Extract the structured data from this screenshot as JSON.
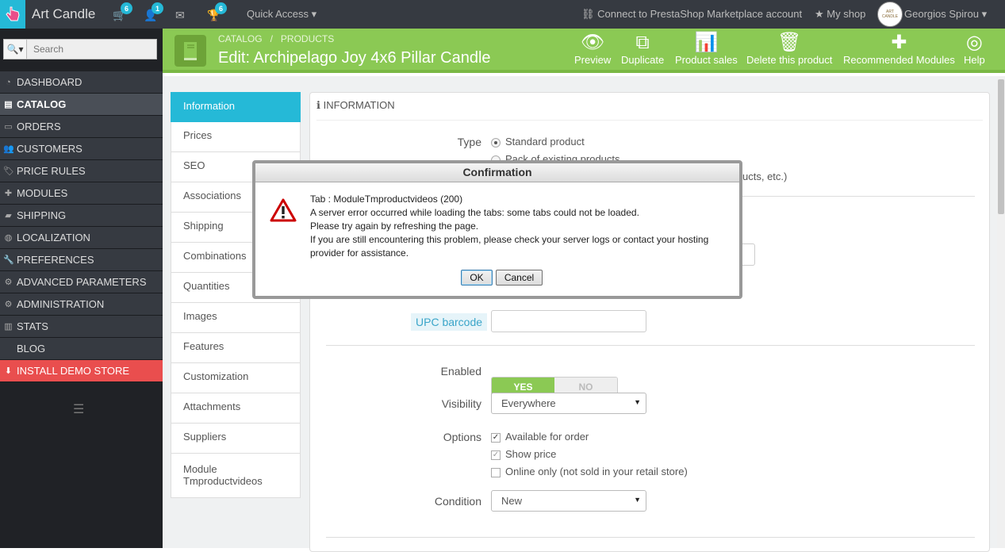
{
  "topbar": {
    "shop_name": "Art Candle",
    "badges": {
      "orders": "6",
      "customers": "1",
      "messages": "",
      "trophy": "6"
    },
    "quick_access": "Quick Access",
    "marketplace": "Connect to PrestaShop Marketplace account",
    "my_shop": "My shop",
    "user": "Georgios Spirou",
    "avatar_text": "ART CANDLE"
  },
  "search": {
    "placeholder": "Search"
  },
  "sidebar": {
    "items": [
      {
        "label": "DASHBOARD",
        "icon": "dashboard-icon"
      },
      {
        "label": "CATALOG",
        "icon": "book-icon"
      },
      {
        "label": "ORDERS",
        "icon": "credit-card-icon"
      },
      {
        "label": "CUSTOMERS",
        "icon": "users-icon"
      },
      {
        "label": "PRICE RULES",
        "icon": "tag-icon"
      },
      {
        "label": "MODULES",
        "icon": "puzzle-icon"
      },
      {
        "label": "SHIPPING",
        "icon": "truck-icon"
      },
      {
        "label": "LOCALIZATION",
        "icon": "globe-icon"
      },
      {
        "label": "PREFERENCES",
        "icon": "wrench-icon"
      },
      {
        "label": "ADVANCED PARAMETERS",
        "icon": "cogs-icon"
      },
      {
        "label": "ADMINISTRATION",
        "icon": "cog-icon"
      },
      {
        "label": "STATS",
        "icon": "bar-chart-icon"
      },
      {
        "label": "BLOG",
        "icon": ""
      },
      {
        "label": "INSTALL DEMO STORE",
        "icon": "download-icon"
      }
    ]
  },
  "header": {
    "breadcrumb": [
      "CATALOG",
      "/",
      "PRODUCTS"
    ],
    "title": "Edit: Archipelago Joy 4x6 Pillar Candle",
    "toolbar": {
      "preview": "Preview",
      "duplicate": "Duplicate",
      "product_sales": "Product sales",
      "delete": "Delete this product",
      "recommended": "Recommended Modules",
      "help": "Help"
    }
  },
  "tabs": [
    "Information",
    "Prices",
    "SEO",
    "Associations",
    "Shipping",
    "Combinations",
    "Quantities",
    "Images",
    "Features",
    "Customization",
    "Attachments",
    "Suppliers",
    "Module Tmproductvideos"
  ],
  "panel": {
    "title": "INFORMATION",
    "type_label": "Type",
    "type_options": [
      "Standard product",
      "Pack of existing products"
    ],
    "virtual_partial": "ucts, etc.)",
    "upc_label": "UPC barcode",
    "enabled_label": "Enabled",
    "yes": "YES",
    "no": "NO",
    "visibility_label": "Visibility",
    "visibility_value": "Everywhere",
    "options_label": "Options",
    "options": [
      {
        "label": "Available for order",
        "checked": true
      },
      {
        "label": "Show price",
        "checked": true
      },
      {
        "label": "Online only (not sold in your retail store)",
        "checked": false
      }
    ],
    "condition_label": "Condition",
    "condition_value": "New"
  },
  "dialog": {
    "title": "Confirmation",
    "lines": [
      "Tab : ModuleTmproductvideos (200)",
      "A server error occurred while loading the tabs: some tabs could not be loaded.",
      "Please try again by refreshing the page.",
      "If you are still encountering this problem, please check your server logs or contact your hosting provider for assistance."
    ],
    "ok": "OK",
    "cancel": "Cancel"
  },
  "colors": {
    "accent": "#25b9d7",
    "header_green": "#8bc954",
    "demo_red": "#e94e4e"
  }
}
